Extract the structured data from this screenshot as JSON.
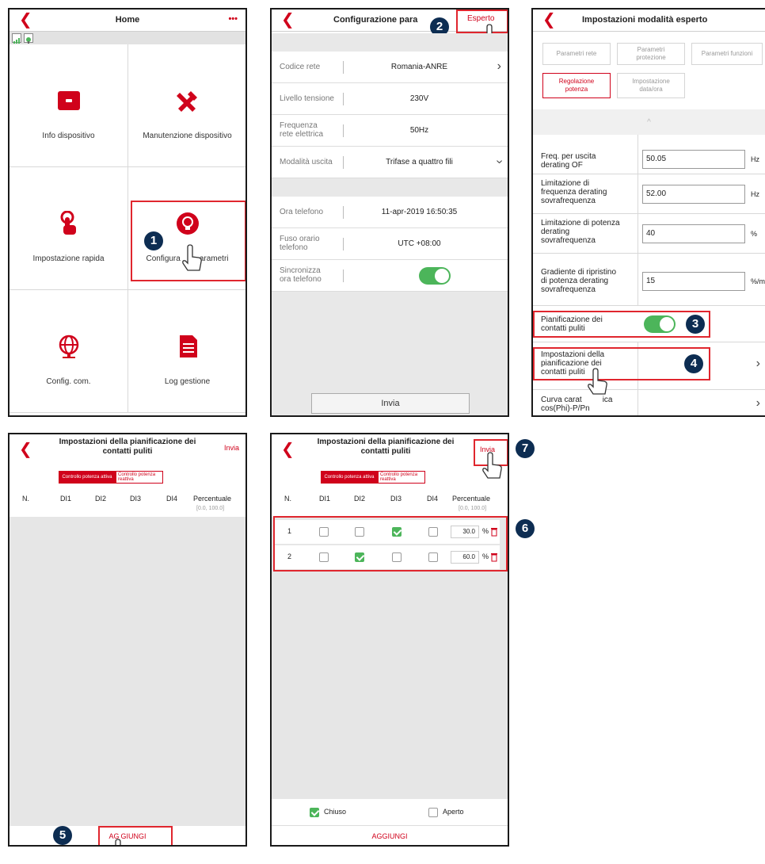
{
  "p1": {
    "title": "Home",
    "more": "•••",
    "items": [
      {
        "label": "Info dispositivo"
      },
      {
        "label": "Manutenzione dispositivo"
      },
      {
        "label": "Impostazione rapida"
      },
      {
        "label": "Configurazione parametri",
        "visible_label": "Configura",
        "visible_label2": "arametri"
      },
      {
        "label": "Config. com."
      },
      {
        "label": "Log gestione"
      }
    ],
    "badge": "1"
  },
  "p2": {
    "title": "Configurazione para",
    "expert": "Esperto",
    "badge": "2",
    "rows": [
      {
        "k": "Codice rete",
        "v": "Romania-ANRE"
      },
      {
        "k": "Livello tensione",
        "v": "230V"
      },
      {
        "k": "Frequenza\nrete elettrica",
        "k1": "Frequenza",
        "k2": "rete elettrica",
        "v": "50Hz"
      },
      {
        "k": "Modalità uscita",
        "v": "Trifase a quattro fili"
      }
    ],
    "rows2": [
      {
        "k": "Ora telefono",
        "v": "11-apr-2019 16:50:35"
      },
      {
        "k1": "Fuso orario",
        "k2": "telefono",
        "v": "UTC +08:00"
      },
      {
        "k1": "Sincronizza",
        "k2": "ora telefono"
      }
    ],
    "send": "Invia"
  },
  "p3": {
    "title": "Impostazioni modalità esperto",
    "tabs": [
      {
        "l1": "Parametri rete"
      },
      {
        "l1": "Parametri",
        "l2": "protezione"
      },
      {
        "l1": "Parametri funzioni"
      },
      {
        "l1": "Regolazione",
        "l2": "potenza"
      },
      {
        "l1": "Impostazione",
        "l2": "data/ora"
      }
    ],
    "caret": "^",
    "rows": [
      {
        "l1": "Freq. per uscita",
        "l2": "derating OF",
        "val": "50.05",
        "unit": "Hz"
      },
      {
        "l1": "Limitazione di",
        "l2": "frequenza derating",
        "l3": "sovrafrequenza",
        "val": "52.00",
        "unit": "Hz"
      },
      {
        "l1": "Limitazione di potenza",
        "l2": "derating",
        "l3": "sovrafrequenza",
        "val": "40",
        "unit": "%"
      },
      {
        "l1": "Gradiente di ripristino",
        "l2": "di potenza derating",
        "l3": "sovrafrequenza",
        "val": "15",
        "unit": "%/m"
      }
    ],
    "sched": {
      "l1": "Pianificazione dei",
      "l2": "contatti puliti"
    },
    "sched_set": {
      "l1": "Impostazioni della",
      "l2": "pianificazione dei",
      "l3": "contatti puliti"
    },
    "curve": {
      "l1": "Curva caratteristica",
      "l1_visible": "Curva carat",
      "l1_tail": "ica",
      "l2": "cos(Phi)-P/Pn"
    },
    "badge3": "3",
    "badge4": "4"
  },
  "p4": {
    "title1": "Impostazioni della pianificazione dei",
    "title2": "contatti puliti",
    "send": "Invia",
    "seg_on": "Controllo potenza attiva",
    "seg_off": "Controllo potenza reattiva",
    "cols": [
      "N.",
      "DI1",
      "DI2",
      "DI3",
      "DI4",
      "Percentuale"
    ],
    "range": "[0.0, 100.0]",
    "add": "AGGIUNGI",
    "add_visible1": "AG",
    "add_visible2": "GIUNGI",
    "badge": "5"
  },
  "p5": {
    "title1": "Impostazioni della pianificazione dei",
    "title2": "contatti puliti",
    "send": "Invia",
    "seg_on": "Controllo potenza attiva",
    "seg_off": "Controllo potenza reattiva",
    "cols": [
      "N.",
      "DI1",
      "DI2",
      "DI3",
      "DI4",
      "Percentuale"
    ],
    "range": "[0.0, 100.0]",
    "rows": [
      {
        "n": "1",
        "di": [
          false,
          false,
          true,
          false
        ],
        "pct": "30.0"
      },
      {
        "n": "2",
        "di": [
          false,
          true,
          false,
          false
        ],
        "pct": "60.0"
      }
    ],
    "pct_unit": "%",
    "closed": "Chiuso",
    "open": "Aperto",
    "add": "AGGIUNGI",
    "badge6": "6",
    "badge7": "7"
  },
  "colors": {
    "accent": "#d0021b",
    "badge": "#0d2d52",
    "toggle": "#4cb55a",
    "callout": "#e0262e"
  }
}
